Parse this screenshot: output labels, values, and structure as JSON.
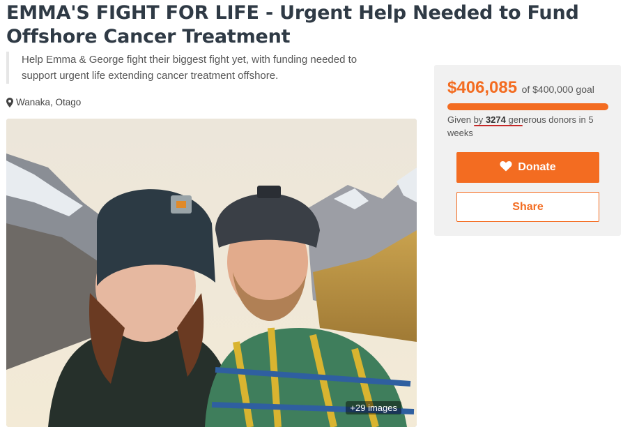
{
  "campaign": {
    "title": "EMMA'S FIGHT FOR LIFE - Urgent Help Needed to Fund Offshore Cancer Treatment",
    "subtitle": "Help Emma & George fight their biggest fight yet, with funding needed to support urgent life extending cancer treatment offshore.",
    "location": "Wanaka, Otago",
    "location_icon": "map-pin-icon",
    "photo": {
      "description": "photo",
      "image_count_label": "+29 images"
    }
  },
  "funding": {
    "raised": "$406,085",
    "goal_text": "of $400,000 goal",
    "progress_fraction": 1.0,
    "donors_prefix": "Given by",
    "donor_count": "3274",
    "donors_suffix": "generous donors in 5 weeks"
  },
  "actions": {
    "donate_label": "Donate",
    "donate_icon": "heart-icon",
    "share_label": "Share"
  },
  "colors": {
    "accent": "#f36c21",
    "title": "#2f3a45",
    "panel_bg": "#f1f1f1",
    "annotation": "#c62828"
  }
}
